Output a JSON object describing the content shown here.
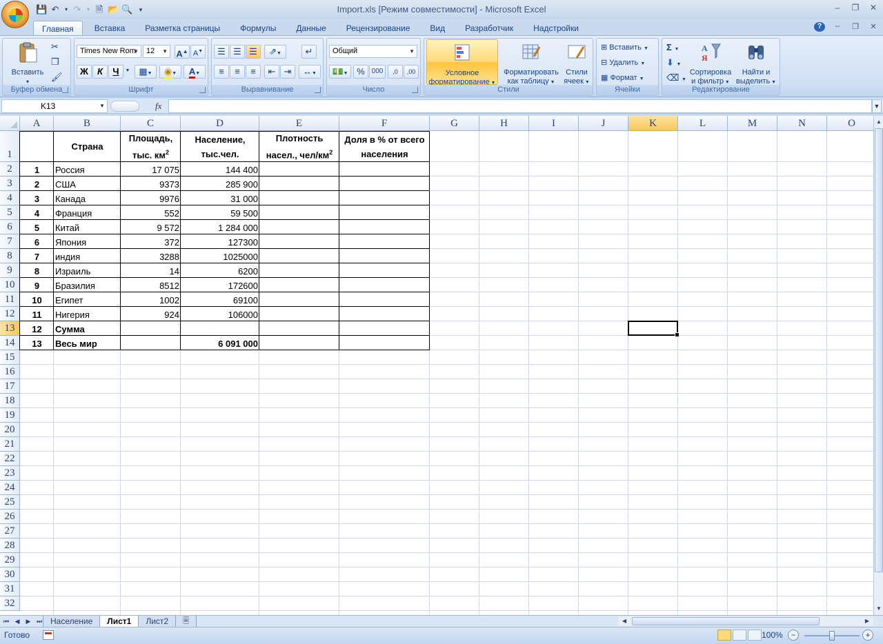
{
  "window": {
    "title": "Import.xls  [Режим совместимости] - Microsoft Excel"
  },
  "ribbon": {
    "tabs": [
      "Главная",
      "Вставка",
      "Разметка страницы",
      "Формулы",
      "Данные",
      "Рецензирование",
      "Вид",
      "Разработчик",
      "Надстройки"
    ],
    "active_tab": "Главная",
    "clipboard": {
      "label": "Буфер обмена",
      "paste": "Вставить"
    },
    "font": {
      "label": "Шрифт",
      "font_name": "Times New Rom",
      "font_size": "12",
      "bold": "Ж",
      "italic": "К",
      "underline": "Ч"
    },
    "alignment": {
      "label": "Выравнивание"
    },
    "number": {
      "label": "Число",
      "format": "Общий",
      "percent": "%",
      "thousands": "000"
    },
    "styles": {
      "label": "Стили",
      "cond_format_1": "Условное",
      "cond_format_2": "форматирование",
      "format_table_1": "Форматировать",
      "format_table_2": "как таблицу",
      "cell_styles_1": "Стили",
      "cell_styles_2": "ячеек"
    },
    "cells": {
      "label": "Ячейки",
      "insert": "Вставить",
      "delete": "Удалить",
      "format": "Формат"
    },
    "editing": {
      "label": "Редактирование",
      "sort_1": "Сортировка",
      "sort_2": "и фильтр",
      "find_1": "Найти и",
      "find_2": "выделить",
      "sum_symbol": "Σ"
    }
  },
  "formula_bar": {
    "name_box": "K13",
    "fx": "fx",
    "formula": ""
  },
  "sheet": {
    "columns": [
      "A",
      "B",
      "C",
      "D",
      "E",
      "F",
      "G",
      "H",
      "I",
      "J",
      "K",
      "L",
      "M",
      "N",
      "O"
    ],
    "selected_column": "K",
    "selected_row": "13",
    "row_numbers": [
      "1",
      "2",
      "3",
      "4",
      "5",
      "6",
      "7",
      "8",
      "9",
      "10",
      "11",
      "12",
      "13",
      "14",
      "15",
      "16",
      "17",
      "18",
      "19",
      "20",
      "21",
      "22",
      "23",
      "24",
      "25",
      "26",
      "27",
      "28",
      "29",
      "30",
      "31",
      "32"
    ],
    "header": {
      "country": "Страна",
      "area_1": "Площадь,",
      "area_2": "тыс. км",
      "pop_1": "Население,",
      "pop_2": "тыс.чел.",
      "density_1": "Плотность",
      "density_2": "насел., чел/км",
      "share_1": "Доля в % от всего",
      "share_2": "населения",
      "superscript": "2"
    },
    "rows": [
      {
        "n": "1",
        "country": "Россия",
        "area": "17 075",
        "pop": "144 400"
      },
      {
        "n": "2",
        "country": "США",
        "area": "9373",
        "pop": "285 900"
      },
      {
        "n": "3",
        "country": "Канада",
        "area": "9976",
        "pop": "31 000"
      },
      {
        "n": "4",
        "country": "Франция",
        "area": "552",
        "pop": "59 500"
      },
      {
        "n": "5",
        "country": "Китай",
        "area": "9 572",
        "pop": "1 284 000"
      },
      {
        "n": "6",
        "country": "Япония",
        "area": "372",
        "pop": "127300"
      },
      {
        "n": "7",
        "country": "индия",
        "area": "3288",
        "pop": "1025000"
      },
      {
        "n": "8",
        "country": "Израиль",
        "area": "14",
        "pop": "6200"
      },
      {
        "n": "9",
        "country": "Бразилия",
        "area": "8512",
        "pop": "172600"
      },
      {
        "n": "10",
        "country": "Египет",
        "area": "1002",
        "pop": "69100"
      },
      {
        "n": "11",
        "country": "Нигерия",
        "area": "924",
        "pop": "106000"
      },
      {
        "n": "12",
        "country": "Сумма",
        "area": "",
        "pop": ""
      },
      {
        "n": "13",
        "country": "Весь мир",
        "area": "",
        "pop": "6 091 000"
      }
    ]
  },
  "sheet_tabs": [
    "Население",
    "Лист1",
    "Лист2"
  ],
  "active_sheet": "Лист1",
  "status": {
    "text": "Готово",
    "zoom": "100%"
  }
}
